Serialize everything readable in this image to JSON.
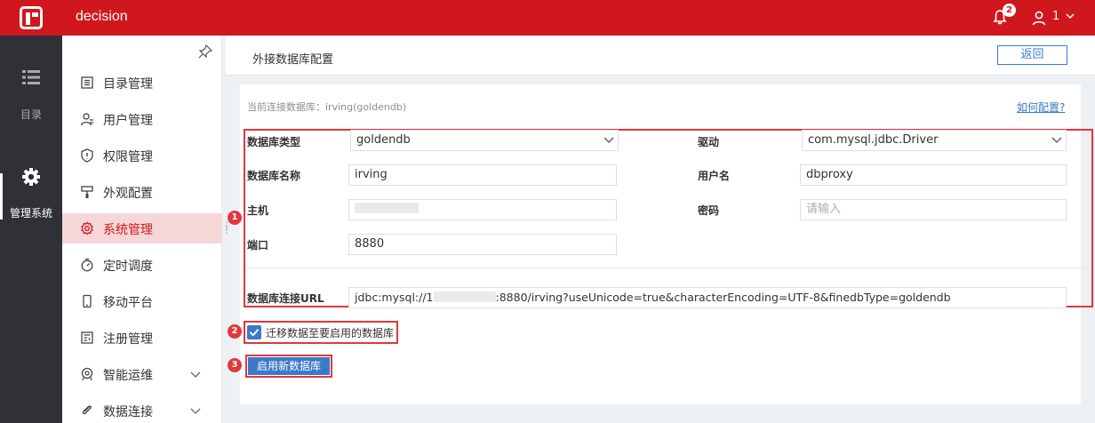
{
  "app": {
    "title": "decision"
  },
  "header": {
    "notification_count": "2",
    "user_name": "1"
  },
  "leftnav": {
    "catalog_label": "目录",
    "system_label": "管理系统"
  },
  "sidebar": {
    "items": [
      {
        "label": "目录管理",
        "icon": "catalog-icon"
      },
      {
        "label": "用户管理",
        "icon": "user-icon"
      },
      {
        "label": "权限管理",
        "icon": "shield-icon"
      },
      {
        "label": "外观配置",
        "icon": "brush-icon"
      },
      {
        "label": "系统管理",
        "icon": "gear-icon",
        "active": true
      },
      {
        "label": "定时调度",
        "icon": "timer-icon"
      },
      {
        "label": "移动平台",
        "icon": "mobile-icon"
      },
      {
        "label": "注册管理",
        "icon": "register-icon"
      },
      {
        "label": "智能运维",
        "icon": "ops-icon",
        "expandable": true
      },
      {
        "label": "数据连接",
        "icon": "link-icon",
        "expandable": true
      }
    ]
  },
  "page": {
    "title": "外接数据库配置",
    "back_label": "返回"
  },
  "card": {
    "current_db_label": "当前连接数据库：irving(goldendb)",
    "howto_label": "如何配置?"
  },
  "form": {
    "db_type": {
      "label": "数据库类型",
      "value": "goldendb"
    },
    "driver": {
      "label": "驱动",
      "value": "com.mysql.jdbc.Driver"
    },
    "db_name": {
      "label": "数据库名称",
      "value": "irving"
    },
    "username": {
      "label": "用户名",
      "value": "dbproxy"
    },
    "host": {
      "label": "主机",
      "value": ""
    },
    "password": {
      "label": "密码",
      "placeholder": "请输入"
    },
    "port": {
      "label": "端口",
      "value": "8880"
    },
    "url": {
      "label": "数据库连接URL",
      "prefix": "jdbc:mysql://1",
      "suffix": ":8880/irving?useUnicode=true&characterEncoding=UTF-8&finedbType=goldendb"
    }
  },
  "migrate": {
    "label": "迁移数据至要启用的数据库",
    "checked": true
  },
  "actions": {
    "enable_label": "启用新数据库"
  },
  "markers": [
    "1",
    "2",
    "3"
  ],
  "colors": {
    "brand": "#d0171d",
    "accent": "#3b7ac8",
    "highlight": "#e0383d"
  }
}
